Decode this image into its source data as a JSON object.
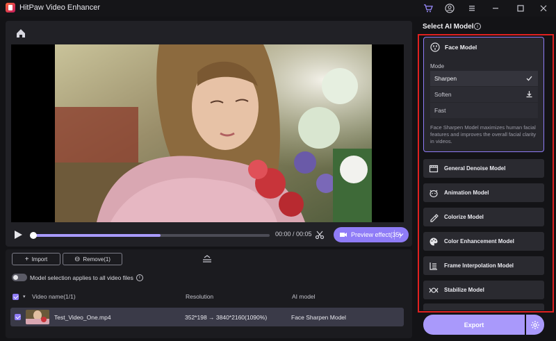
{
  "app": {
    "title": "HitPaw Video Enhancer"
  },
  "titlebar": {
    "icons": [
      "cart-icon",
      "account-icon",
      "menu-icon",
      "minimize-icon",
      "maximize-icon",
      "close-icon"
    ]
  },
  "player": {
    "time": "00:00 / 00:05",
    "progress": 0.54,
    "preview_label": "Preview effect(35)"
  },
  "file_panel": {
    "import_label": "Import",
    "remove_label": "Remove(1)",
    "toggle_label": "Model selection applies to all video files",
    "columns": {
      "name": "Video name(1/1)",
      "resolution": "Resolution",
      "model": "AI model"
    },
    "row": {
      "name": "Test_Video_One.mp4",
      "resolution": "352*198 → 3840*2160(1090%)",
      "model": "Face Sharpen Model"
    }
  },
  "model_panel": {
    "title": "Select AI Model",
    "face": {
      "title": "Face Model",
      "mode_label": "Mode",
      "modes": [
        "Sharpen",
        "Soften",
        "Fast"
      ],
      "selected_mode": "Sharpen",
      "description": "Face Sharpen Model maximizes human facial features and improves the overall facial clarity in videos."
    },
    "models": [
      "General Denoise Model",
      "Animation Model",
      "Colorize Model",
      "Color Enhancement Model",
      "Frame Interpolation Model",
      "Stabilize Model"
    ],
    "export_label": "Export"
  },
  "colors": {
    "accent": "#8f7cf7",
    "highlight": "#e02020",
    "export": "#a999fb"
  }
}
